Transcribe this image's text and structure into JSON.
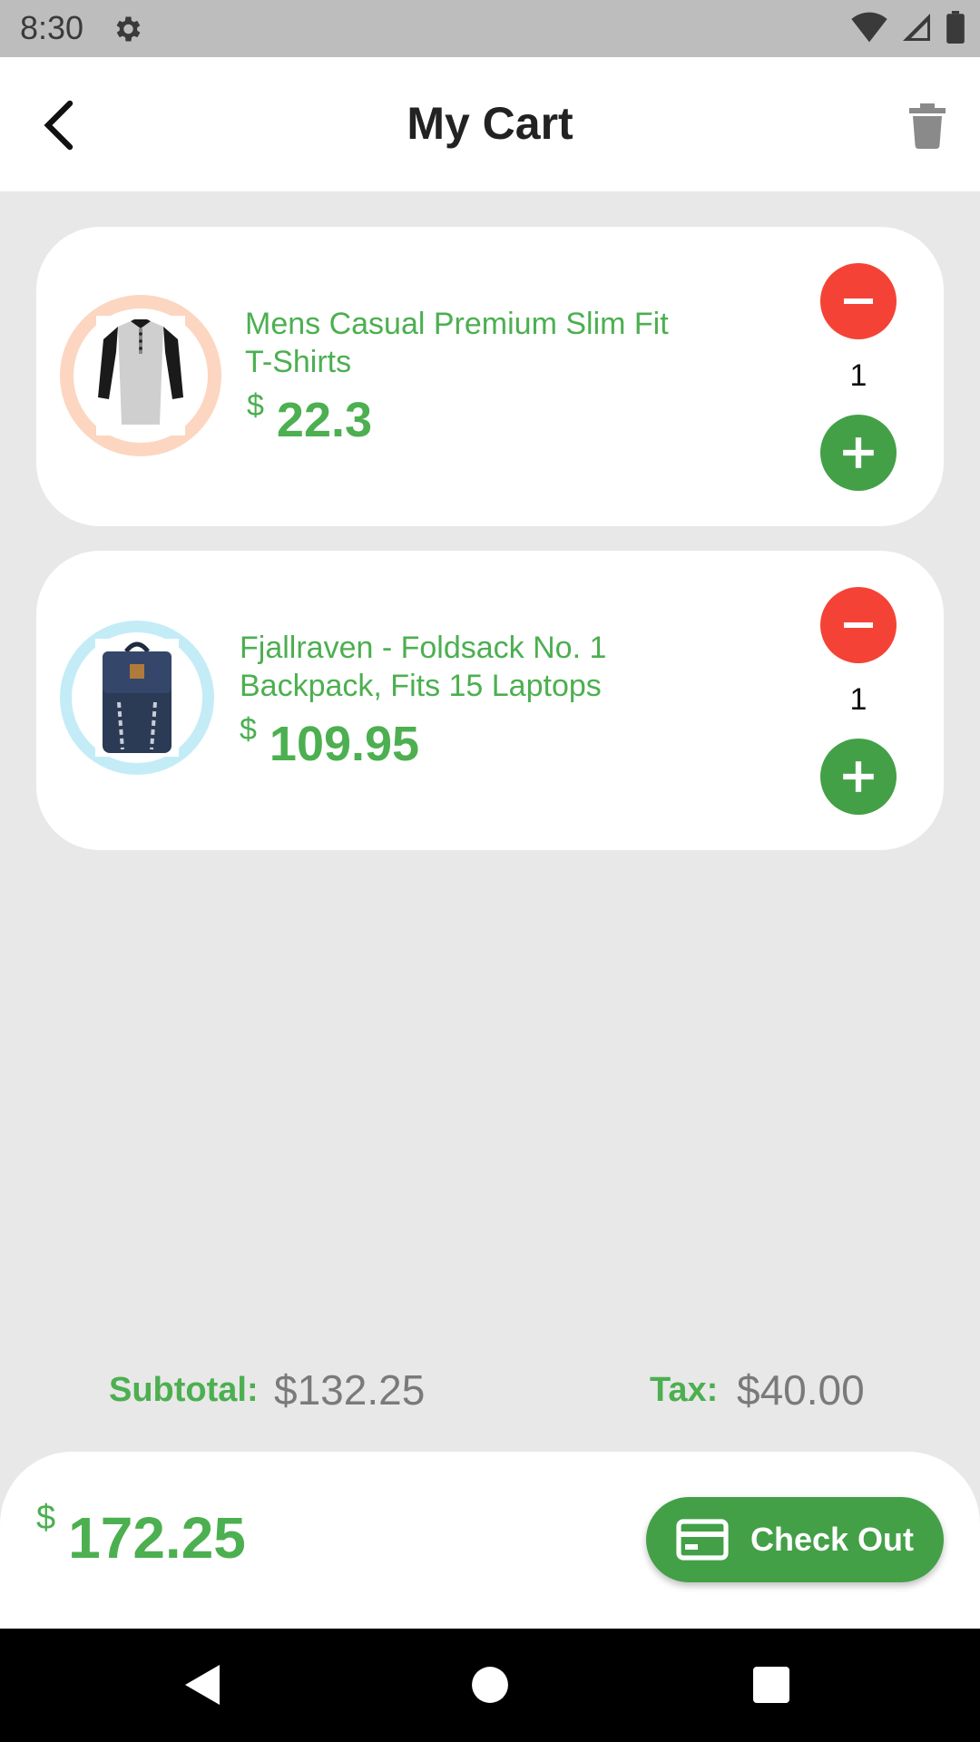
{
  "status_bar": {
    "time": "8:30",
    "icons": [
      "gear-icon",
      "wifi-icon",
      "signal-icon",
      "battery-icon"
    ]
  },
  "app_bar": {
    "title": "My Cart",
    "back_icon": "chevron-left-icon",
    "delete_icon": "trash-icon"
  },
  "cart": {
    "items": [
      {
        "name": "Mens Casual Premium Slim Fit T-Shirts",
        "currency": "$",
        "price": "22.3",
        "quantity": "1",
        "image": "tshirt-image",
        "ring_color": "#fcd6c0"
      },
      {
        "name": "Fjallraven - Foldsack No. 1 Backpack, Fits 15 Laptops",
        "currency": "$",
        "price": "109.95",
        "quantity": "1",
        "image": "backpack-image",
        "ring_color": "#c4ecf7"
      }
    ]
  },
  "totals": {
    "subtotal_label": "Subtotal:",
    "subtotal_value": "$132.25",
    "tax_label": "Tax:",
    "tax_value": "$40.00"
  },
  "footer": {
    "currency": "$",
    "total": "172.25",
    "checkout_label": "Check Out",
    "checkout_icon": "credit-card-icon"
  },
  "colors": {
    "accent_green": "#4caf50",
    "button_green": "#43a047",
    "minus_red": "#f44336",
    "background": "#e8e8e8"
  }
}
